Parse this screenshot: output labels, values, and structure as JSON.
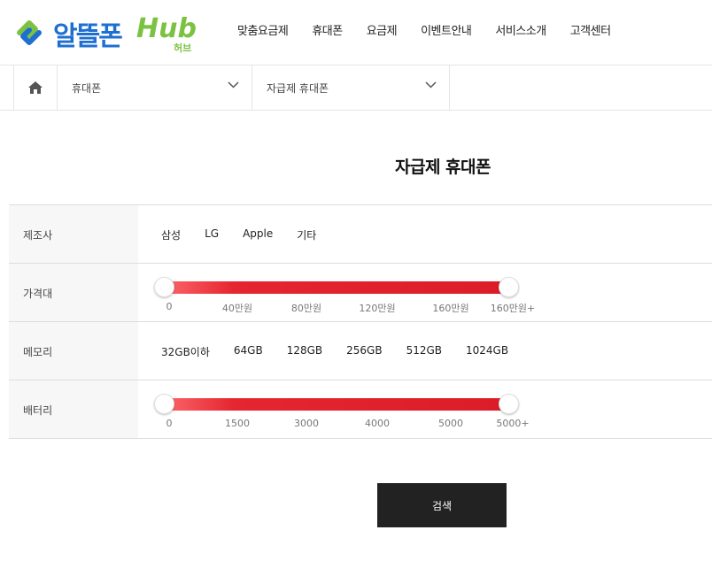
{
  "logo": {
    "name": "알뜰폰",
    "hub": "Hub",
    "sub": "허브"
  },
  "nav": [
    "맞춤요금제",
    "휴대폰",
    "요금제",
    "이벤트안내",
    "서비스소개",
    "고객센터"
  ],
  "breadcrumb": {
    "first": "휴대폰",
    "second": "자급제 휴대폰"
  },
  "page_title": "자급제 휴대폰",
  "filters": {
    "manufacturer": {
      "label": "제조사",
      "options": [
        "삼성",
        "LG",
        "Apple",
        "기타"
      ]
    },
    "price": {
      "label": "가격대",
      "ticks": [
        "0",
        "40만원",
        "80만원",
        "120만원",
        "160만원",
        "160만원+"
      ],
      "range_min": 0,
      "range_max": 1
    },
    "memory": {
      "label": "메모리",
      "options": [
        "32GB이하",
        "64GB",
        "128GB",
        "256GB",
        "512GB",
        "1024GB"
      ]
    },
    "battery": {
      "label": "배터리",
      "ticks": [
        "0",
        "1500",
        "3000",
        "4000",
        "5000",
        "5000+"
      ],
      "range_min": 0,
      "range_max": 1
    }
  },
  "search_label": "검색",
  "colors": {
    "accent_red": "#dc1c27",
    "logo_blue": "#1e6fd1",
    "logo_green": "#7cc242",
    "button_dark": "#222222"
  }
}
